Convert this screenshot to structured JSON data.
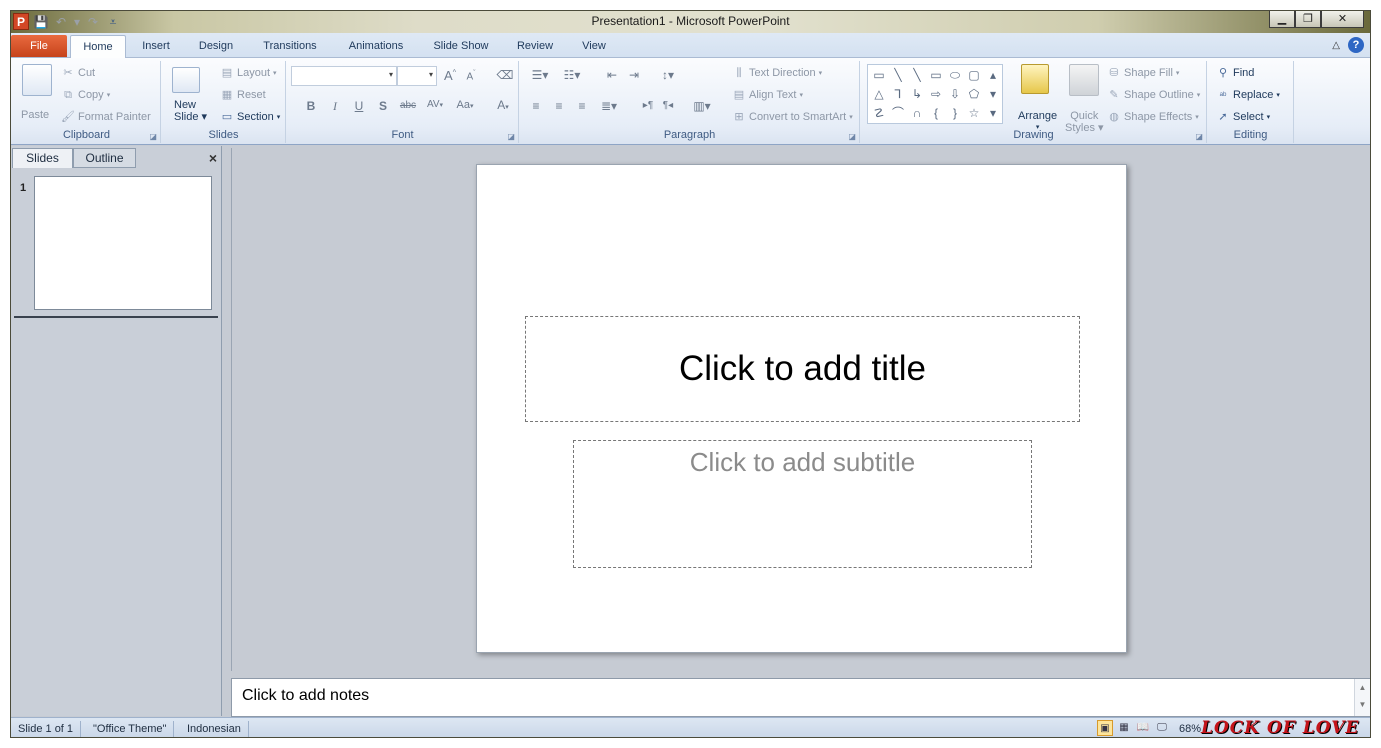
{
  "window": {
    "title": "Presentation1 - Microsoft PowerPoint",
    "app_icon_letter": "P",
    "controls": [
      "▁",
      "❐",
      "✕"
    ]
  },
  "quick_access": {
    "icons": [
      "save-icon",
      "undo-icon",
      "redo-icon",
      "customize-icon"
    ],
    "glyphs": [
      "💾",
      "↶",
      "▾",
      "↷",
      "⩡"
    ]
  },
  "tabs": {
    "file": "File",
    "items": [
      "Home",
      "Insert",
      "Design",
      "Transitions",
      "Animations",
      "Slide Show",
      "Review",
      "View"
    ],
    "active": "Home"
  },
  "ribbon": {
    "clipboard": {
      "label": "Clipboard",
      "paste": "Paste",
      "cut": "Cut",
      "copy": "Copy",
      "format_painter": "Format Painter"
    },
    "slides": {
      "label": "Slides",
      "new_slide_line1": "New",
      "new_slide_line2": "Slide",
      "layout": "Layout",
      "reset": "Reset",
      "section": "Section"
    },
    "font": {
      "label": "Font",
      "font_name": "",
      "font_size": "",
      "bold": "B",
      "italic": "I",
      "underline": "U",
      "shadow": "S",
      "strike": "abc",
      "spacing": "AV",
      "case": "Aa",
      "color": "A",
      "grow": "A",
      "shrink": "A"
    },
    "paragraph": {
      "label": "Paragraph",
      "text_direction": "Text Direction",
      "align_text": "Align Text",
      "convert_smartart": "Convert to SmartArt"
    },
    "drawing": {
      "label": "Drawing",
      "arrange": "Arrange",
      "quick_styles_line1": "Quick",
      "quick_styles_line2": "Styles",
      "shape_fill": "Shape Fill",
      "shape_outline": "Shape Outline",
      "shape_effects": "Shape Effects",
      "shapes": [
        "▭",
        "╲",
        "╲",
        "▭",
        "⬭",
        "▢",
        "▴",
        "△",
        "⅂",
        "↳",
        "⇨",
        "⇩",
        "⬠",
        "▾",
        "☡",
        "⌒",
        "∩",
        "{",
        "}",
        "☆",
        "▾"
      ]
    },
    "editing": {
      "label": "Editing",
      "find": "Find",
      "replace": "Replace",
      "select": "Select"
    }
  },
  "left_pane": {
    "tabs": [
      "Slides",
      "Outline"
    ],
    "active_tab": "Slides",
    "close": "×",
    "thumb_number": "1"
  },
  "slide": {
    "title_placeholder": "Click to add title",
    "subtitle_placeholder": "Click to add subtitle"
  },
  "notes": {
    "placeholder": "Click to add notes"
  },
  "status": {
    "slide_info": "Slide 1 of 1",
    "theme": "\"Office Theme\"",
    "language": "Indonesian",
    "zoom": "68%"
  },
  "watermark": "LOCK OF LOVE"
}
